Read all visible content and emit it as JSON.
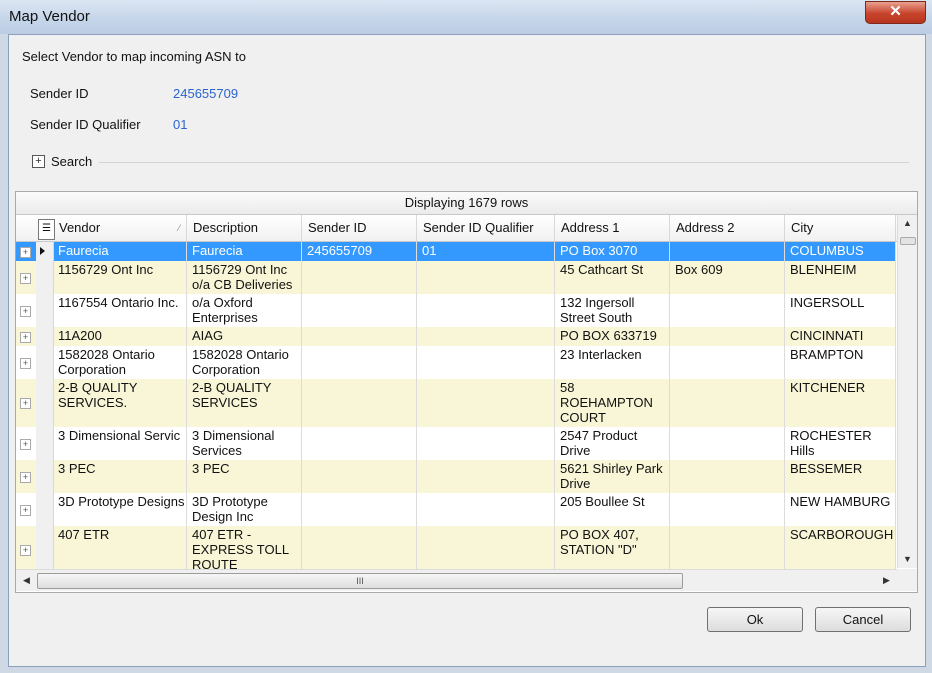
{
  "window": {
    "title": "Map Vendor",
    "close_glyph": "✕"
  },
  "prompt": "Select Vendor to map incoming ASN to",
  "sender": {
    "id_label": "Sender ID",
    "id_value": "245655709",
    "qualifier_label": "Sender ID Qualifier",
    "qualifier_value": "01"
  },
  "search": {
    "toggle_glyph": "+",
    "label": "Search"
  },
  "grid": {
    "caption": "Displaying 1679 rows",
    "columns": [
      "Vendor",
      "Description",
      "Sender ID",
      "Sender ID Qualifier",
      "Address 1",
      "Address 2",
      "City"
    ],
    "selected_row": 0,
    "rows": [
      {
        "vendor": "Faurecia",
        "description": "Faurecia",
        "sender_id": "245655709",
        "qualifier": "01",
        "address1": "PO Box 3070",
        "address2": "",
        "city": "COLUMBUS"
      },
      {
        "vendor": "1156729 Ont Inc",
        "description": "1156729 Ont Inc o/a CB Deliveries",
        "sender_id": "",
        "qualifier": "",
        "address1": "45 Cathcart St",
        "address2": "Box 609",
        "city": "BLENHEIM"
      },
      {
        "vendor": "1167554 Ontario Inc.",
        "description": "o/a Oxford Enterprises",
        "sender_id": "",
        "qualifier": "",
        "address1": "132 Ingersoll Street South",
        "address2": "",
        "city": "INGERSOLL"
      },
      {
        "vendor": "11A200",
        "description": "AIAG",
        "sender_id": "",
        "qualifier": "",
        "address1": "PO BOX 633719",
        "address2": "",
        "city": "CINCINNATI"
      },
      {
        "vendor": "1582028 Ontario Corporation",
        "description": "1582028 Ontario Corporation",
        "sender_id": "",
        "qualifier": "",
        "address1": "23 Interlacken",
        "address2": "",
        "city": "BRAMPTON"
      },
      {
        "vendor": "2-B QUALITY SERVICES.",
        "description": "2-B QUALITY SERVICES",
        "sender_id": "",
        "qualifier": "",
        "address1": "58 ROEHAMPTON COURT",
        "address2": "",
        "city": "KITCHENER"
      },
      {
        "vendor": "3 Dimensional Servic",
        "description": "3 Dimensional Services",
        "sender_id": "",
        "qualifier": "",
        "address1": "2547 Product Drive",
        "address2": "",
        "city": "ROCHESTER Hills"
      },
      {
        "vendor": "3 PEC",
        "description": "3 PEC",
        "sender_id": "",
        "qualifier": "",
        "address1": "5621 Shirley Park Drive",
        "address2": "",
        "city": "BESSEMER"
      },
      {
        "vendor": "3D Prototype Designs",
        "description": "3D Prototype Design Inc",
        "sender_id": "",
        "qualifier": "",
        "address1": "205 Boullee St",
        "address2": "",
        "city": "NEW HAMBURG"
      },
      {
        "vendor": "407 ETR",
        "description": "407 ETR - EXPRESS TOLL ROUTE",
        "sender_id": "",
        "qualifier": "",
        "address1": "PO BOX 407, STATION \"D\"",
        "address2": "",
        "city": "SCARBOROUGH"
      }
    ],
    "column_chooser_icon": "column-chooser-icon",
    "sort_indicator": "⁄",
    "scroll_glyphs": {
      "up": "▲",
      "down": "▼",
      "left": "◀",
      "right": "▶",
      "grip": "III"
    }
  },
  "buttons": {
    "ok": "Ok",
    "cancel": "Cancel"
  },
  "colors": {
    "link_value": "#2b64d0",
    "row_alt": "#f8f6d6",
    "selection": "#3399ff",
    "close": "#c7442c"
  }
}
